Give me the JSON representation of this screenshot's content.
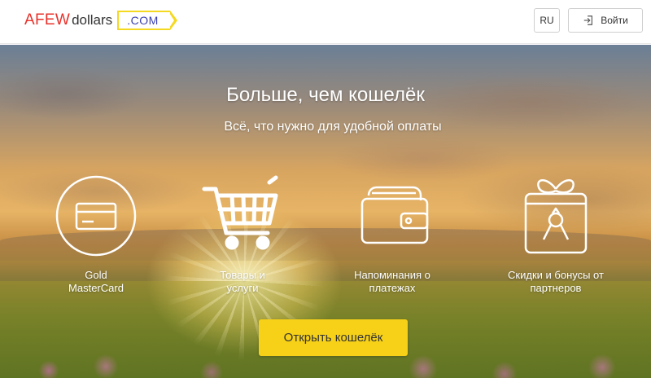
{
  "header": {
    "logo_part1": "AFEW",
    "logo_part2": "dollars",
    "logo_part3": ".COM",
    "lang_label": "RU",
    "login_label": "Войти"
  },
  "hero": {
    "title": "Больше, чем кошелёк",
    "subtitle": "Всё, что нужно для удобной оплаты",
    "features": [
      {
        "label_line1": "Gold",
        "label_line2": "MasterCard",
        "icon": "credit-card-icon"
      },
      {
        "label_line1": "Товары и",
        "label_line2": "услуги",
        "icon": "shopping-cart-icon"
      },
      {
        "label_line1": "Напоминания о",
        "label_line2": "платежах",
        "icon": "wallet-icon"
      },
      {
        "label_line1": "Скидки и бонусы от",
        "label_line2": "партнеров",
        "icon": "gift-icon"
      }
    ],
    "cta_label": "Открыть кошелёк"
  },
  "colors": {
    "logo_red": "#e8322b",
    "logo_yellow": "#f5d820",
    "logo_blue": "#3a3fb0",
    "cta_yellow": "#f7d117"
  }
}
